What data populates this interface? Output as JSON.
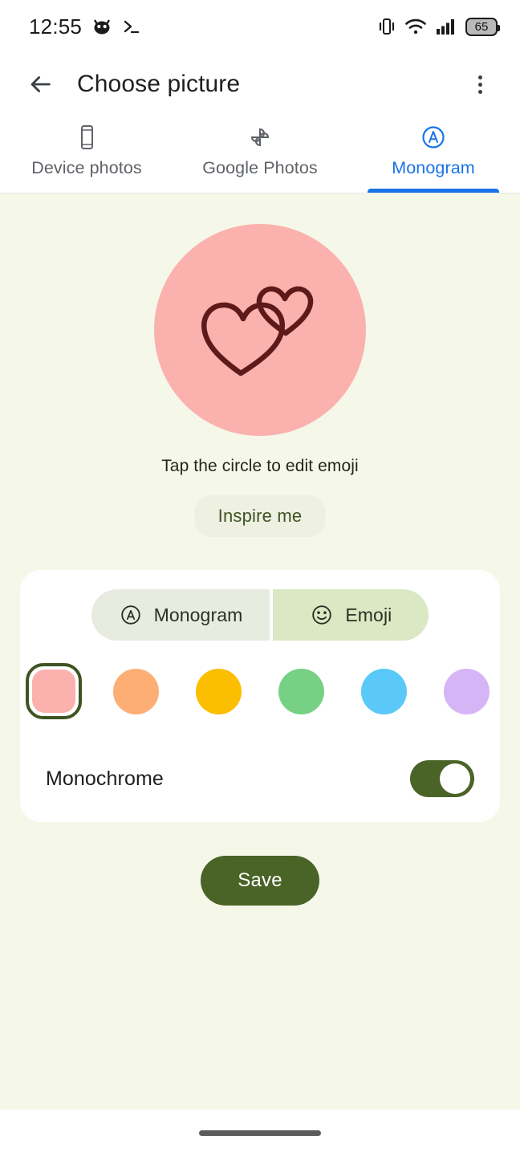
{
  "status_bar": {
    "clock": "12:55",
    "battery_level": "65",
    "icons": [
      "cat-icon",
      "terminal-icon",
      "vibrate-icon",
      "wifi-icon",
      "cell-signal-icon",
      "battery-icon"
    ]
  },
  "app_bar": {
    "back_icon": "arrow-back-icon",
    "title": "Choose picture",
    "overflow_icon": "more-vert-icon"
  },
  "tabs": [
    {
      "label": "Device photos",
      "icon": "phone-icon",
      "active": false
    },
    {
      "label": "Google Photos",
      "icon": "pinwheel-icon",
      "active": false
    },
    {
      "label": "Monogram",
      "icon": "monogram-a-icon",
      "active": true
    }
  ],
  "preview": {
    "background_color": "#fbb2ae",
    "emoji_name": "two-hearts",
    "stroke_color": "#5e1a1a",
    "hint": "Tap the circle to edit emoji",
    "inspire_label": "Inspire me"
  },
  "card": {
    "segmented": [
      {
        "label": "Monogram",
        "icon": "monogram-a-icon",
        "selected": false
      },
      {
        "label": "Emoji",
        "icon": "smiley-face-icon",
        "selected": true
      }
    ],
    "swatches": [
      {
        "name": "pink",
        "color": "#fbb2ae",
        "selected": true
      },
      {
        "name": "orange",
        "color": "#fcae74",
        "selected": false
      },
      {
        "name": "yellow",
        "color": "#fcbe00",
        "selected": false
      },
      {
        "name": "green",
        "color": "#77d184",
        "selected": false
      },
      {
        "name": "blue",
        "color": "#5ac8f8",
        "selected": false
      },
      {
        "name": "purple",
        "color": "#d6b5f7",
        "selected": false
      }
    ],
    "selection_ring_color": "#3f5422",
    "monochrome": {
      "label": "Monochrome",
      "enabled": true,
      "track_color": "#4a6327"
    }
  },
  "save": {
    "label": "Save",
    "color": "#4a6327"
  },
  "theme": {
    "page_background": "#f5f8e8",
    "card_background": "#ffffff",
    "accent_blue": "#1a73e8",
    "accent_green": "#4a6327"
  },
  "nav_bar": {
    "home_indicator": "home-pill"
  }
}
